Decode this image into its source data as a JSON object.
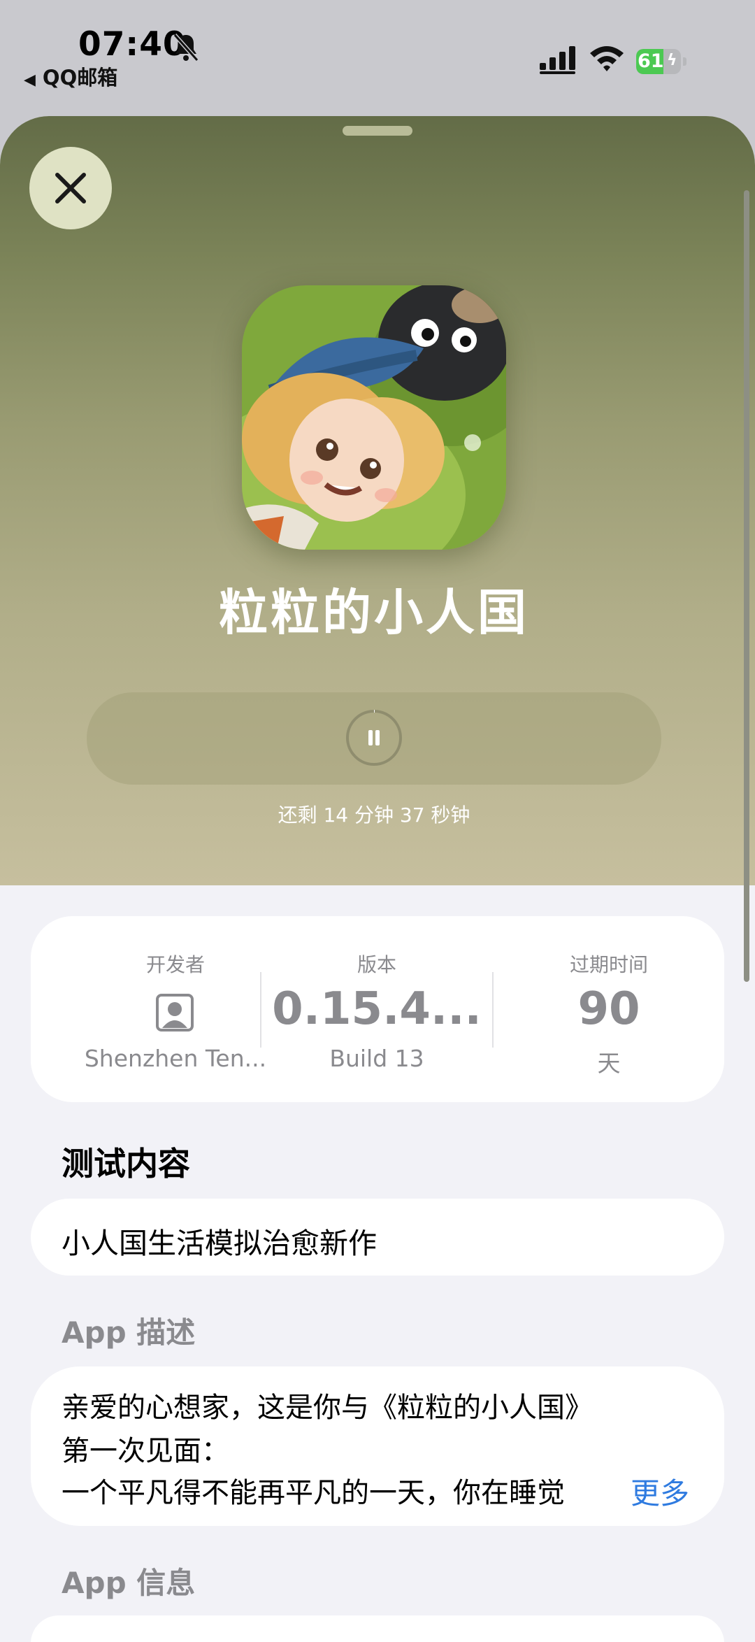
{
  "status_bar": {
    "time": "07:40",
    "back_app": "QQ邮箱",
    "battery_level": "61"
  },
  "app": {
    "name": "粒粒的小人国",
    "remaining_time": "还剩 14 分钟 37 秒钟"
  },
  "info": {
    "developer_label": "开发者",
    "developer_name": "Shenzhen Ten...",
    "version_label": "版本",
    "version_value": "0.15.4...",
    "build": "Build 13",
    "expiry_label": "过期时间",
    "expiry_value": "90",
    "expiry_unit": "天"
  },
  "test_content": {
    "title": "测试内容",
    "text": "小人国生活模拟治愈新作"
  },
  "app_description": {
    "title": "App 描述",
    "line1": "亲爱的心想家，这是你与《粒粒的小人国》",
    "line2": "第一次见面：",
    "line3": "一个平凡得不能再平凡的一天，你在睡觉",
    "more": "更多"
  },
  "app_info": {
    "title": "App 信息"
  },
  "colors": {
    "accent": "#2f7be0",
    "battery": "#4cc952",
    "hero_top": "#636c47",
    "hero_bottom": "#c6bf9e"
  },
  "icons": [
    "bell-slash-icon",
    "signal-icon",
    "wifi-icon",
    "battery-icon",
    "close-icon",
    "pause-icon",
    "person-icon"
  ]
}
